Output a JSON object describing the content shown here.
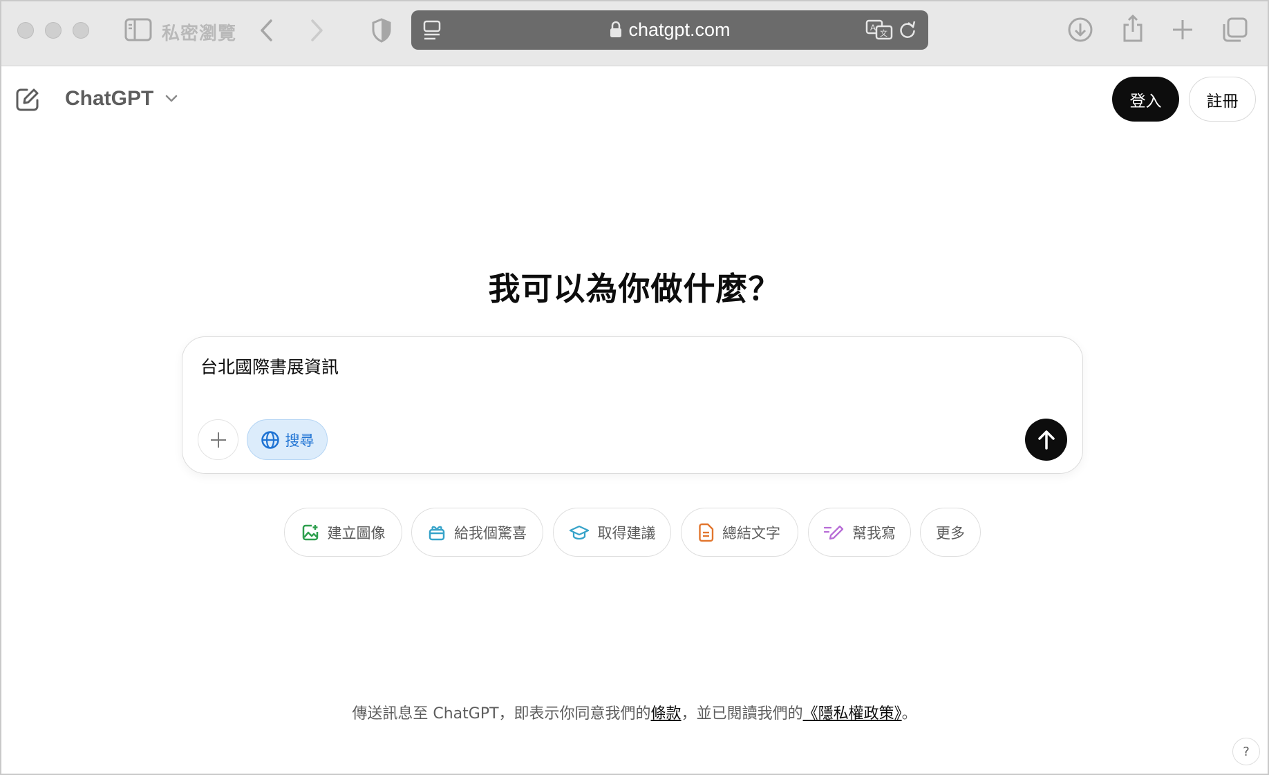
{
  "browser": {
    "private_label": "私密瀏覽",
    "address": "chatgpt.com"
  },
  "header": {
    "app_title": "ChatGPT",
    "login_label": "登入",
    "signup_label": "註冊"
  },
  "main": {
    "headline": "我可以為你做什麼？",
    "composer": {
      "input_value": "台北國際書展資訊",
      "search_label": "搜尋"
    },
    "suggestions": [
      {
        "label": "建立圖像",
        "icon": "image-icon",
        "color": "#2e9f4e"
      },
      {
        "label": "給我個驚喜",
        "icon": "gift-icon",
        "color": "#36a3c9"
      },
      {
        "label": "取得建議",
        "icon": "graduation-cap-icon",
        "color": "#36a3c9"
      },
      {
        "label": "總結文字",
        "icon": "document-icon",
        "color": "#e2762e"
      },
      {
        "label": "幫我寫",
        "icon": "pen-icon",
        "color": "#b76bd6"
      },
      {
        "label": "更多",
        "icon": "",
        "color": ""
      }
    ]
  },
  "footer": {
    "note_prefix": "傳送訊息至 ChatGPT，即表示你同意我們的",
    "terms_link": "條款",
    "note_middle": "，並已閱讀我們的",
    "privacy_link": "《隱私權政策》",
    "note_suffix": "。",
    "help_label": "?"
  },
  "colors": {
    "accent_blue": "#1f73d3",
    "search_bg": "#dcecfb",
    "primary_button": "#0d0d0d"
  }
}
